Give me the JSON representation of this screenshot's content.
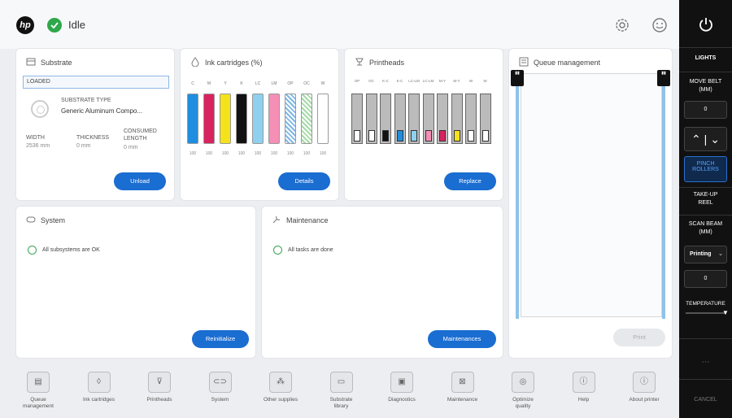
{
  "header": {
    "status": "Idle"
  },
  "substrate": {
    "title": "Substrate",
    "state": "LOADED",
    "type_label": "SUBSTRATE TYPE",
    "type_value": "Generic Aluminum Compo...",
    "width_label": "WIDTH",
    "width_value": "2536 mm",
    "thickness_label": "THICKNESS",
    "thickness_value": "0 mm",
    "consumed_label_1": "CONSUMED",
    "consumed_label_2": "LENGTH",
    "consumed_value": "0 mm",
    "button": "Unload"
  },
  "ink": {
    "title": "Ink cartridges (%)",
    "labels": [
      "C",
      "M",
      "Y",
      "K",
      "LC",
      "LM",
      "OP",
      "OC",
      "W"
    ],
    "values": [
      "100",
      "100",
      "100",
      "100",
      "100",
      "100",
      "100",
      "100",
      "100"
    ],
    "colors": [
      "#1f8de0",
      "#d9235f",
      "#f4e21b",
      "#111111",
      "#8fd0ee",
      "#f58fb5",
      "#ffffff",
      "#ffffff",
      "#ffffff"
    ],
    "button": "Details"
  },
  "printheads": {
    "title": "Printheads",
    "labels": [
      "OP",
      "OC",
      "K-C",
      "K-C",
      "LC-LM",
      "LC-LM",
      "M-Y",
      "M-Y",
      "W",
      "W"
    ],
    "button": "Replace"
  },
  "queue": {
    "title": "Queue management",
    "button": "Print"
  },
  "system": {
    "title": "System",
    "status": "All subsystems are OK",
    "button": "Reinitialize"
  },
  "maintenance": {
    "title": "Maintenance",
    "status": "All tasks are done",
    "button": "Maintenances"
  },
  "bottom_nav": [
    {
      "label1": "Queue",
      "label2": "management",
      "icon": "queue-icon"
    },
    {
      "label1": "Ink cartridges",
      "label2": "",
      "icon": "ink-drop-icon"
    },
    {
      "label1": "Printheads",
      "label2": "",
      "icon": "printhead-icon"
    },
    {
      "label1": "System",
      "label2": "",
      "icon": "system-icon"
    },
    {
      "label1": "Other supplies",
      "label2": "",
      "icon": "supplies-icon"
    },
    {
      "label1": "Substrate",
      "label2": "library",
      "icon": "substrate-library-icon"
    },
    {
      "label1": "Diagnostics",
      "label2": "",
      "icon": "diagnostics-icon"
    },
    {
      "label1": "Maintenance",
      "label2": "",
      "icon": "maintenance-icon"
    },
    {
      "label1": "Optimize",
      "label2": "quality",
      "icon": "optimize-icon"
    },
    {
      "label1": "Help",
      "label2": "",
      "icon": "help-icon"
    },
    {
      "label1": "About printer",
      "label2": "",
      "icon": "about-icon"
    }
  ],
  "right": {
    "lights": "LIGHTS",
    "move_belt_1": "MOVE BELT",
    "move_belt_2": "(MM)",
    "move_belt_value": "0",
    "pinch_1": "PINCH",
    "pinch_2": "ROLLERS",
    "takeup_1": "TAKE-UP",
    "takeup_2": "REEL",
    "scan_1": "SCAN BEAM",
    "scan_2": "(MM)",
    "scan_mode": "Printing",
    "scan_value": "0",
    "temperature": "TEMPERATURE",
    "cancel": "CANCEL"
  },
  "colors": {
    "accent": "#1a6dd1",
    "ok": "#2ea84a",
    "sidebar": "#111111"
  }
}
